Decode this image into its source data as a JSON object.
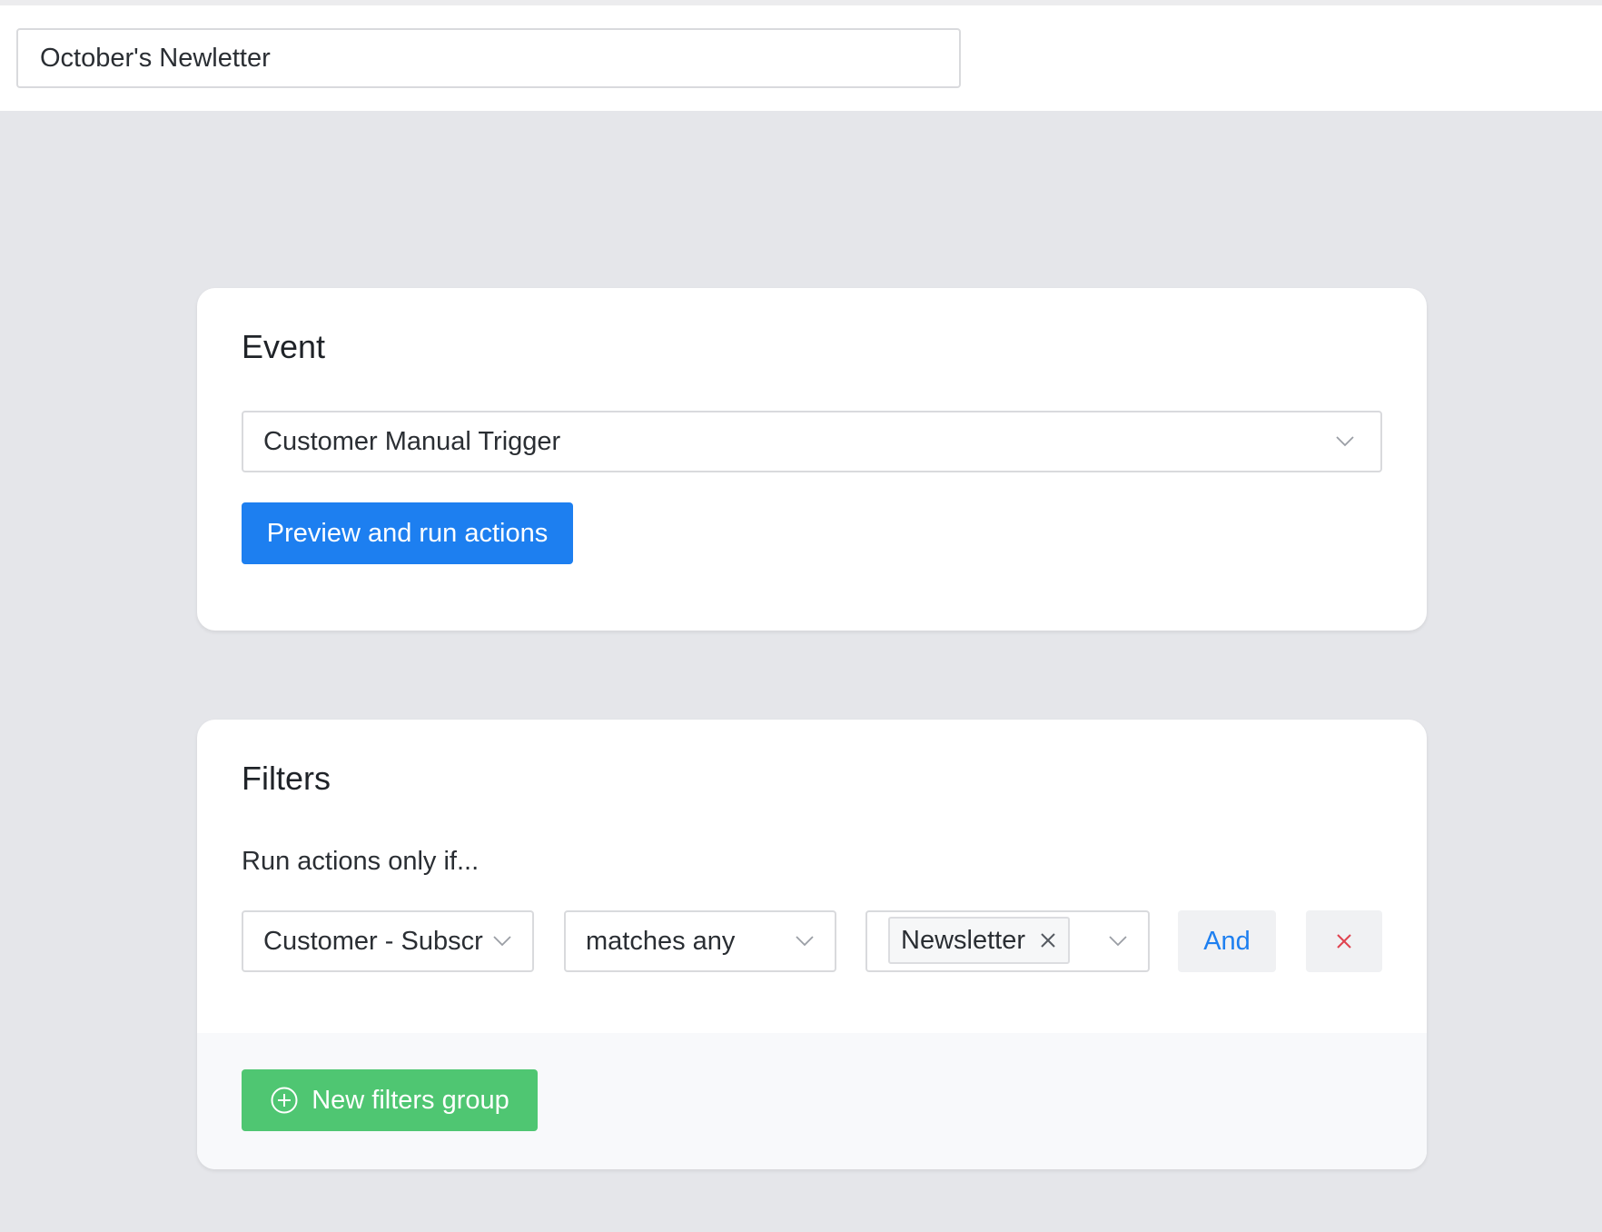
{
  "automation": {
    "name_value": "October's Newletter"
  },
  "event_card": {
    "title": "Event",
    "trigger_selected": "Customer Manual Trigger",
    "preview_button_label": "Preview and run actions"
  },
  "filters_card": {
    "title": "Filters",
    "run_label": "Run actions only if...",
    "condition": {
      "field_selected": "Customer - Subscr",
      "operator_selected": "matches any",
      "values": [
        "Newsletter"
      ]
    },
    "and_button_label": "And",
    "new_group_button_label": "New filters group"
  },
  "icons": {
    "chevron": "chevron-down-icon",
    "tag_remove": "close-icon",
    "remove_condition": "close-icon",
    "add_group": "plus-circle-icon"
  },
  "colors": {
    "primary": "#1d7ff0",
    "success": "#4fc672",
    "danger": "#e0434f",
    "background": "#e5e6ea"
  }
}
